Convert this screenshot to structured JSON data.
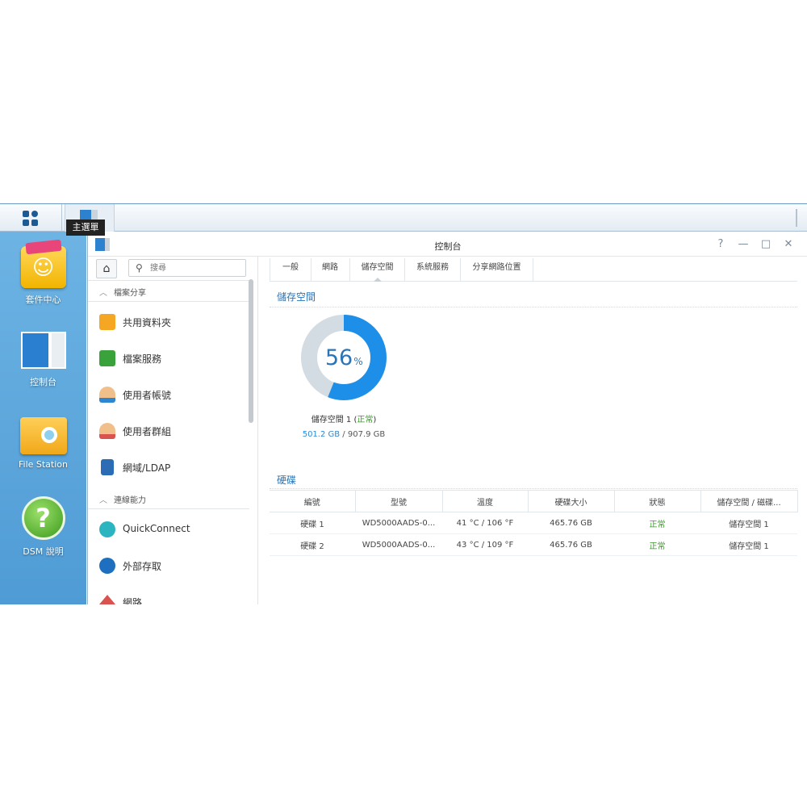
{
  "taskbar": {
    "tooltip": "主選單"
  },
  "desktop": {
    "icons": [
      {
        "label": "套件中心"
      },
      {
        "label": "控制台"
      },
      {
        "label": "File Station"
      },
      {
        "label": "DSM 說明"
      }
    ]
  },
  "window": {
    "title": "控制台",
    "buttons": {
      "help": "?",
      "minimize": "—",
      "maximize": "□",
      "close": "✕"
    }
  },
  "nav": {
    "search_placeholder": "搜尋",
    "sections": [
      {
        "label": "檔案分享",
        "items": [
          {
            "label": "共用資料夾"
          },
          {
            "label": "檔案服務"
          },
          {
            "label": "使用者帳號"
          },
          {
            "label": "使用者群組"
          },
          {
            "label": "網域/LDAP"
          }
        ]
      },
      {
        "label": "連線能力",
        "items": [
          {
            "label": "QuickConnect"
          },
          {
            "label": "外部存取"
          },
          {
            "label": "網路"
          }
        ]
      }
    ]
  },
  "tabs": [
    {
      "label": "一般"
    },
    {
      "label": "網路"
    },
    {
      "label": "儲存空間"
    },
    {
      "label": "系統服務"
    },
    {
      "label": "分享網路位置"
    }
  ],
  "storage": {
    "heading": "儲存空間",
    "percent": 56,
    "percent_num": "56",
    "percent_sign": "%",
    "volume_name": "儲存空間 1",
    "volume_status": "正常",
    "used": "501.2 GB",
    "total": "907.9 GB",
    "colors": {
      "used": "#1e8fe8",
      "free": "#d3dbe3",
      "ok": "#3a9a2a"
    }
  },
  "disks": {
    "heading": "硬碟",
    "columns": [
      "編號",
      "型號",
      "溫度",
      "硬碟大小",
      "狀態",
      "儲存空間 / 磁碟..."
    ],
    "rows": [
      [
        "硬碟 1",
        "WD5000AADS-0...",
        "41 °C / 106 °F",
        "465.76 GB",
        "正常",
        "儲存空間 1"
      ],
      [
        "硬碟 2",
        "WD5000AADS-0...",
        "43 °C / 109 °F",
        "465.76 GB",
        "正常",
        "儲存空間 1"
      ]
    ]
  }
}
